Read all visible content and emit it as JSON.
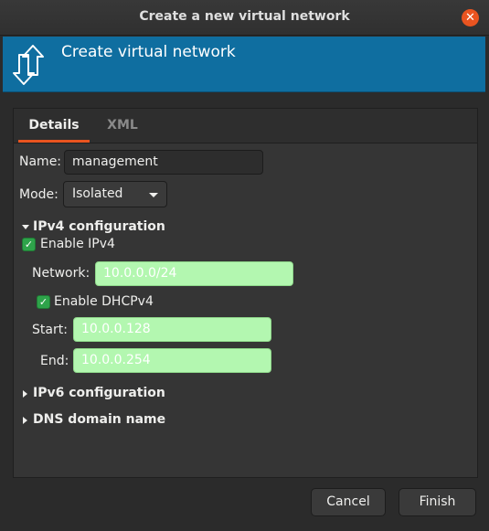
{
  "window": {
    "title": "Create a new virtual network",
    "close_glyph": "✕"
  },
  "banner": {
    "heading": "Create virtual network",
    "icon": "network-arrows-icon",
    "color": "#0f6ea0"
  },
  "tabs": [
    {
      "label": "Details",
      "active": true
    },
    {
      "label": "XML",
      "active": false
    }
  ],
  "form": {
    "name_label": "Name:",
    "name_value": "management",
    "mode_label": "Mode:",
    "mode_value": "Isolated"
  },
  "ipv4": {
    "header": "IPv4 configuration",
    "enable_label": "Enable IPv4",
    "enable_checked": true,
    "network_label": "Network:",
    "network_value": "10.0.0.0/24",
    "dhcp_label": "Enable DHCPv4",
    "dhcp_checked": true,
    "start_label": "Start:",
    "start_value": "10.0.0.128",
    "end_label": "End:",
    "end_value": "10.0.0.254"
  },
  "ipv6": {
    "header": "IPv6 configuration"
  },
  "dns": {
    "header": "DNS domain name"
  },
  "buttons": {
    "cancel": "Cancel",
    "finish": "Finish"
  },
  "colors": {
    "accent": "#e95420",
    "valid_field": "#b3f7b0",
    "checkbox": "#2ea34a"
  }
}
